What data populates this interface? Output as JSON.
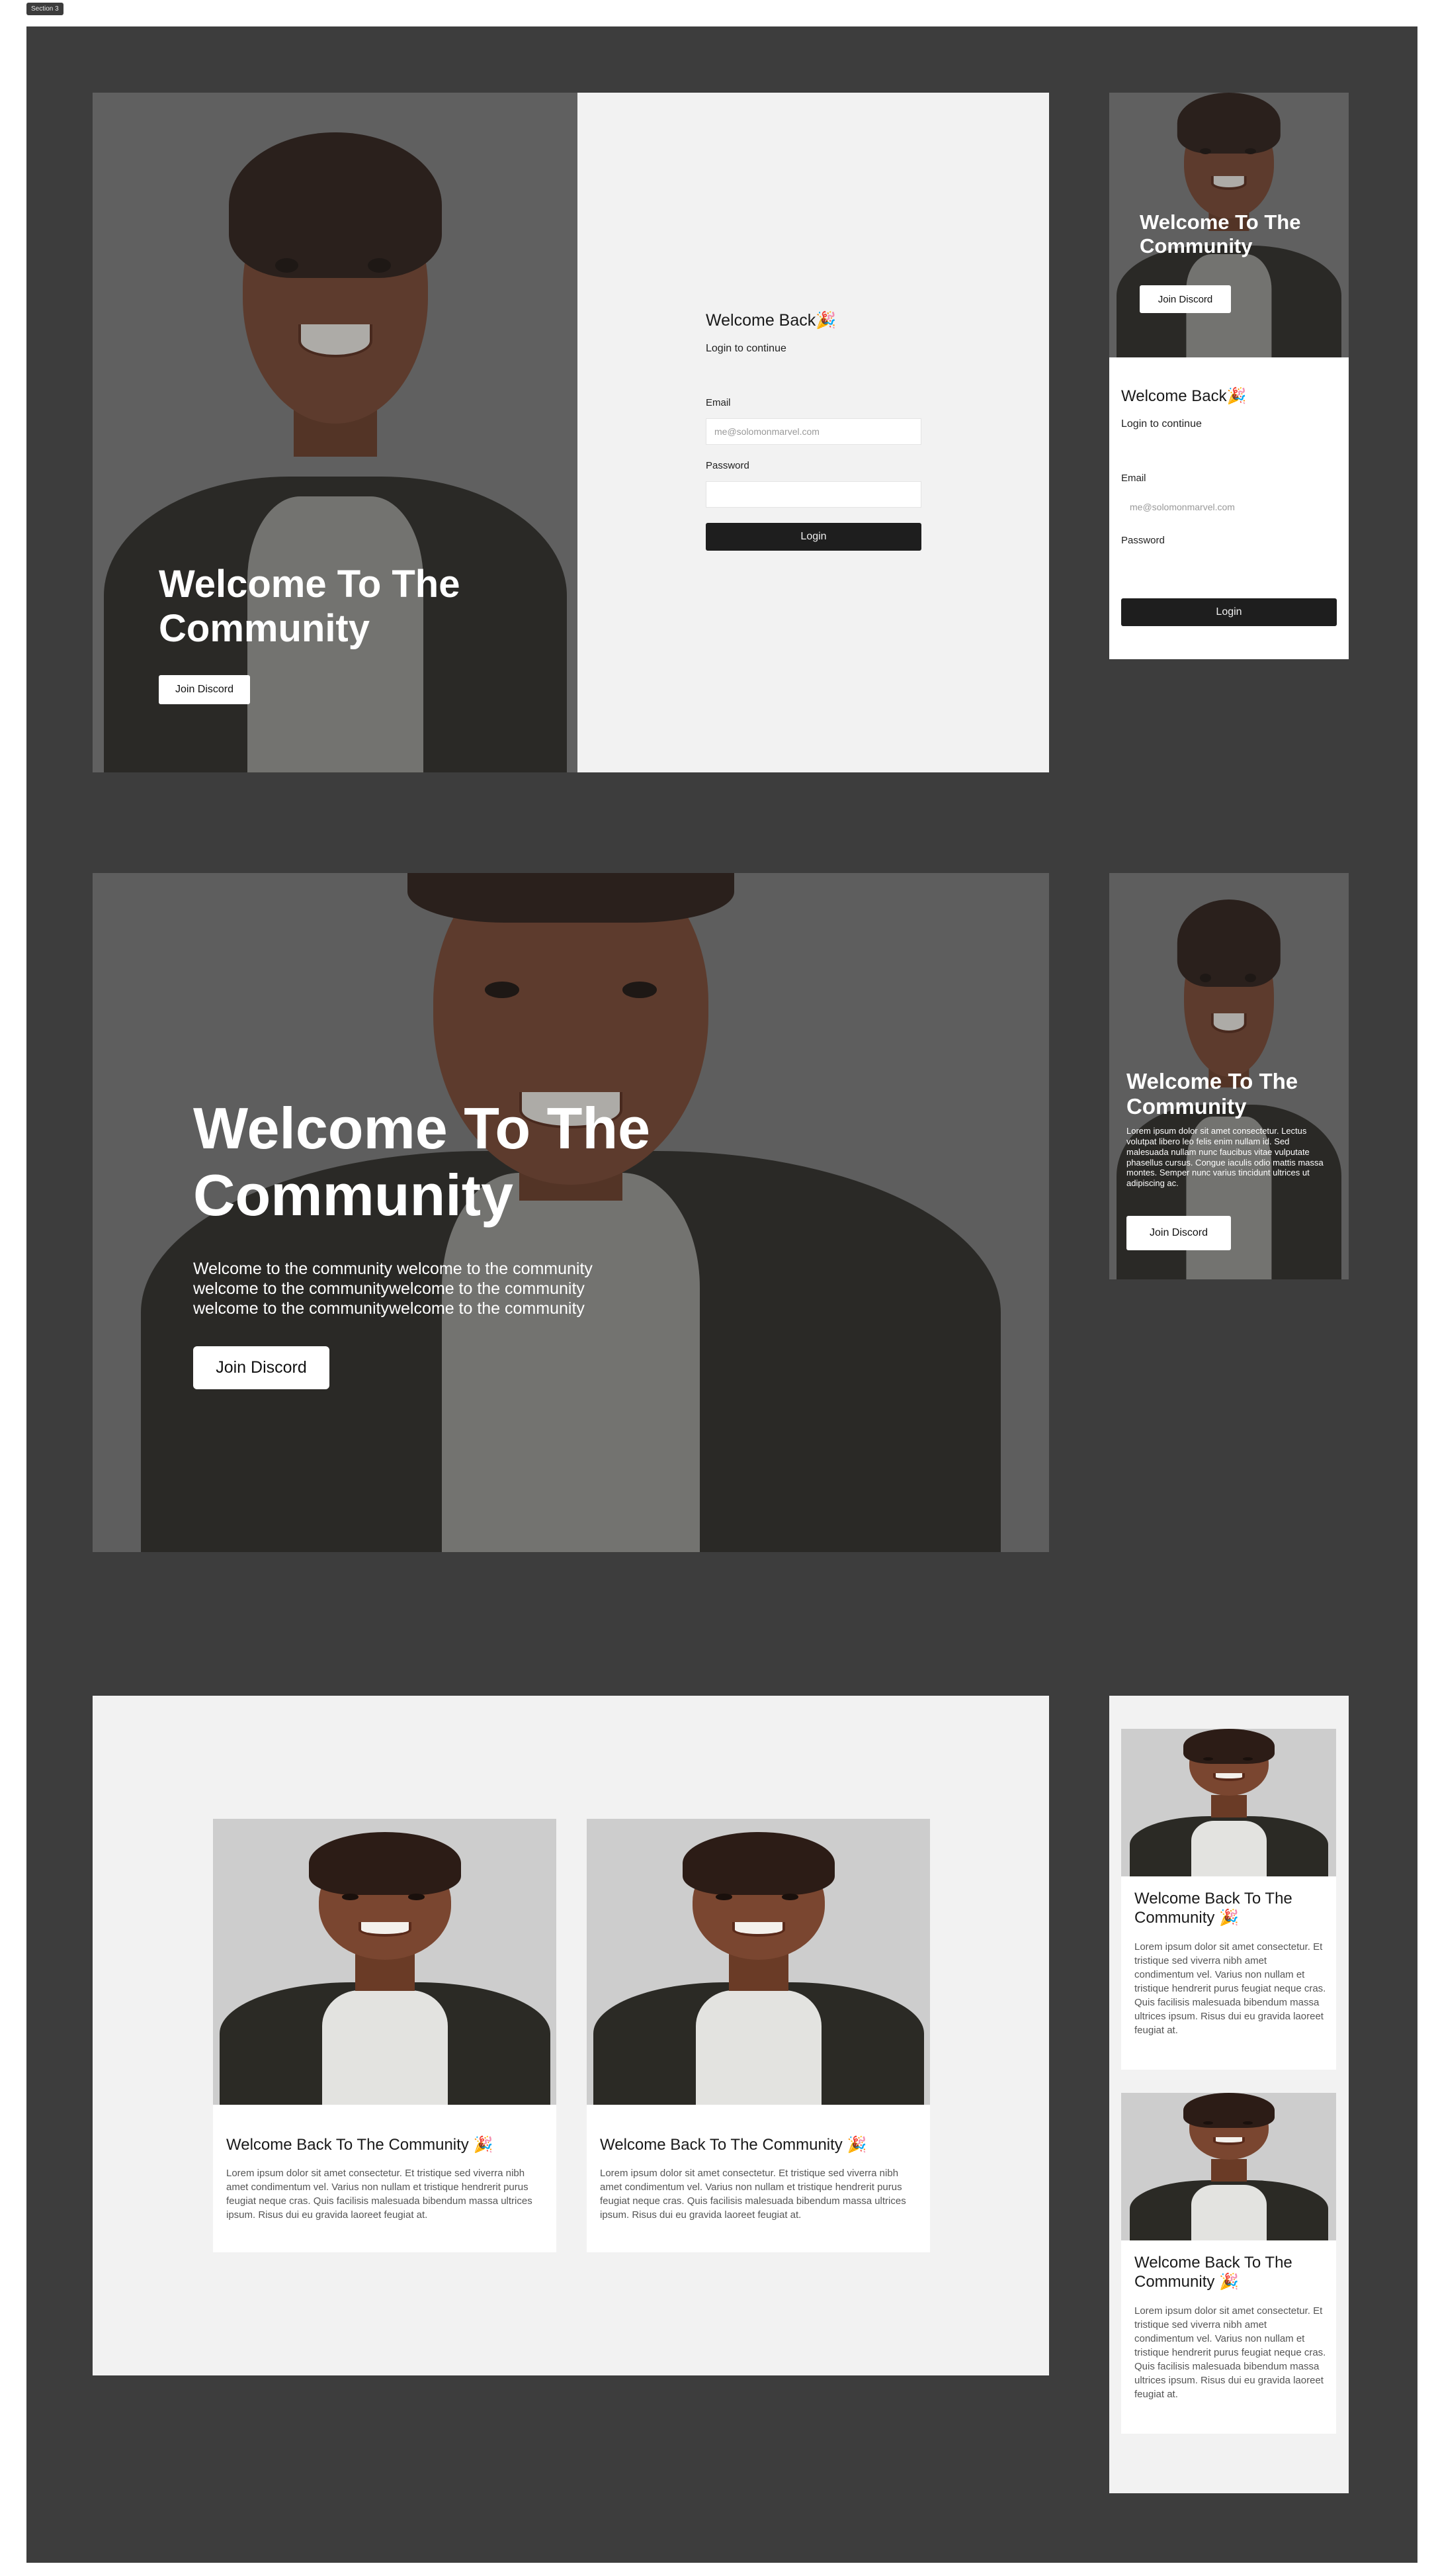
{
  "section_label": "Section 3",
  "login": {
    "heading": "Welcome Back",
    "heading_emoji": "🎉",
    "subheading": "Login to continue",
    "email_label": "Email",
    "email_placeholder": "me@solomonmarvel.com",
    "password_label": "Password",
    "button": "Login"
  },
  "hero": {
    "title": "Welcome To The Community",
    "button": "Join Discord",
    "body_large": "Welcome to the community welcome to the community welcome to the communitywelcome to the community welcome to the communitywelcome to the community",
    "body_small": "Lorem ipsum dolor sit amet consectetur. Lectus volutpat libero leo felis enim nullam id. Sed malesuada nullam nunc faucibus vitae vulputate phasellus cursus. Congue iaculis odio mattis massa montes. Semper nunc varius tincidunt ultrices ut adipiscing ac."
  },
  "cards": {
    "title": "Welcome Back To The Community",
    "emoji": "🎉",
    "body_desktop": "Lorem ipsum dolor sit amet consectetur. Et tristique sed viverra nibh amet condimentum vel. Varius non nullam et tristique hendrerit purus feugiat neque cras. Quis facilisis malesuada bibendum massa ultrices ipsum. Risus dui eu gravida laoreet feugiat at.",
    "body_mobile": "Lorem ipsum dolor sit amet consectetur. Et tristique sed viverra nibh amet condimentum vel. Varius non nullam et tristique hendrerit purus feugiat neque cras. Quis facilisis malesuada bibendum massa ultrices ipsum. Risus dui eu gravida laoreet feugiat at."
  },
  "icons": {
    "confetti": "party-popper-icon",
    "photo": "portrait-photo"
  },
  "colors": {
    "canvas": "#3d3d3d",
    "panel": "#f2f2f2",
    "button_dark": "#1e1e1e",
    "button_light": "#ffffff"
  }
}
